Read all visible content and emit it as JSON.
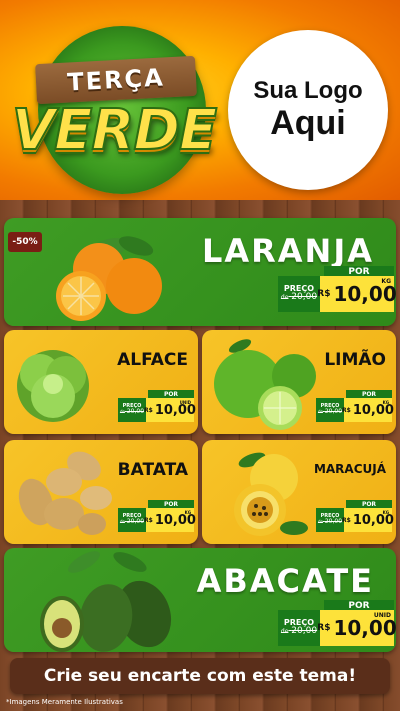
{
  "header": {
    "badge_top": "TERÇA",
    "badge_main": "VERDE",
    "logo_line1": "Sua Logo",
    "logo_line2": "Aqui"
  },
  "products": [
    {
      "name": "LARANJA",
      "discount": "-50%",
      "por": "POR",
      "preco": "PREÇO",
      "de": "de",
      "old_price": "20,00",
      "currency": "R$",
      "new_price": "10,00",
      "unit": "KG"
    },
    {
      "name": "ALFACE",
      "por": "POR",
      "preco": "PREÇO",
      "de": "de",
      "old_price": "20,00",
      "currency": "R$",
      "new_price": "10,00",
      "unit": "UNID"
    },
    {
      "name": "LIMÃO",
      "por": "POR",
      "preco": "PREÇO",
      "de": "de",
      "old_price": "20,00",
      "currency": "R$",
      "new_price": "10,00",
      "unit": "KG"
    },
    {
      "name": "BATATA",
      "por": "POR",
      "preco": "PREÇO",
      "de": "de",
      "old_price": "20,00",
      "currency": "R$",
      "new_price": "10,00",
      "unit": "KG"
    },
    {
      "name": "MARACUJÁ",
      "por": "POR",
      "preco": "PREÇO",
      "de": "de",
      "old_price": "20,00",
      "currency": "R$",
      "new_price": "10,00",
      "unit": "KG"
    },
    {
      "name": "ABACATE",
      "por": "POR",
      "preco": "PREÇO",
      "de": "de",
      "old_price": "20,00",
      "currency": "R$",
      "new_price": "10,00",
      "unit": "UNID"
    }
  ],
  "banner": "Crie seu encarte com este tema!",
  "footnote": "*Imagens Meramente Ilustrativas",
  "colors": {
    "green": "#3f9c24",
    "yellow": "#f7c428",
    "orange": "#f27b00",
    "wood": "#7a4425"
  }
}
